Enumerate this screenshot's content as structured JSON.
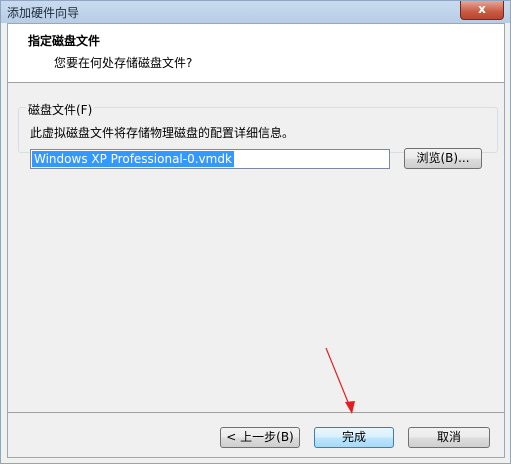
{
  "window": {
    "title": "添加硬件向导",
    "close_label": "x"
  },
  "header": {
    "title": "指定磁盘文件",
    "subtitle": "您要在何处存储磁盘文件?"
  },
  "disk_file": {
    "group_label": "磁盘文件(F)",
    "description": "此虚拟磁盘文件将存储物理磁盘的配置详细信息。",
    "value": "Windows XP Professional-0.vmdk",
    "browse_label": "浏览(B)..."
  },
  "footer": {
    "back_label": "< 上一步(B)",
    "finish_label": "完成",
    "cancel_label": "取消"
  },
  "colors": {
    "accent": "#3399ff",
    "annotation_arrow": "#e02020"
  }
}
